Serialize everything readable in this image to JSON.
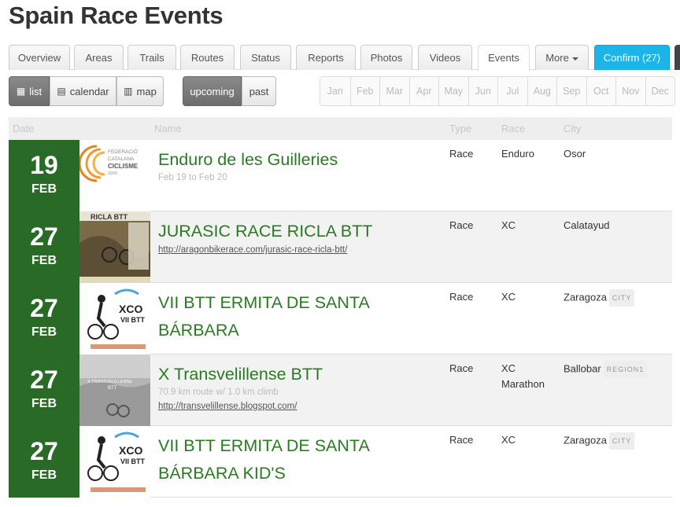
{
  "page": {
    "title": "Spain Race Events"
  },
  "tabs": [
    {
      "label": "Overview"
    },
    {
      "label": "Areas"
    },
    {
      "label": "Trails"
    },
    {
      "label": "Routes"
    },
    {
      "label": "Status"
    },
    {
      "label": "Reports"
    },
    {
      "label": "Photos"
    },
    {
      "label": "Videos"
    },
    {
      "label": "Events"
    },
    {
      "label": "More"
    },
    {
      "label": "Confirm (27)"
    }
  ],
  "view_buttons": {
    "list": "list",
    "calendar": "calendar",
    "map": "map"
  },
  "time_buttons": {
    "upcoming": "upcoming",
    "past": "past"
  },
  "months": [
    "Jan",
    "Feb",
    "Mar",
    "Apr",
    "May",
    "Jun",
    "Jul",
    "Aug",
    "Sep",
    "Oct",
    "Nov",
    "Dec"
  ],
  "table": {
    "headers": {
      "date": "Date",
      "name": "Name",
      "type": "Type",
      "race": "Race",
      "city": "City"
    },
    "rows": [
      {
        "day": "19",
        "month": "FEB",
        "name": "Enduro de les Guilleries",
        "sub": "Feb 19 to Feb 20",
        "link": "",
        "type": "Race",
        "race": "Enduro",
        "city": "Osor",
        "badge": "",
        "thumb_text": "FEDERACIÓ CATALANA CICLISME 1896"
      },
      {
        "day": "27",
        "month": "FEB",
        "name": "JURASIC RACE RICLA BTT",
        "sub": "",
        "link": "http://aragonbikerace.com/jurasic-race-ricla-btt/",
        "type": "Race",
        "race": "XC",
        "city": "Calatayud",
        "badge": "",
        "thumb_text": "RICLA BTT"
      },
      {
        "day": "27",
        "month": "FEB",
        "name": "VII BTT ERMITA DE SANTA BÁRBARA",
        "sub": "",
        "link": "",
        "type": "Race",
        "race": "XC",
        "city": "Zaragoza",
        "badge": "CITY",
        "thumb_text": "XCO VII BTT"
      },
      {
        "day": "27",
        "month": "FEB",
        "name": "X Transvelillense BTT",
        "sub": "70.9 km route w/ 1.0 km climb",
        "link": "http://transvelillense.blogspot.com/",
        "type": "Race",
        "race": "XC Marathon",
        "city": "Ballobar",
        "badge": "REGION1",
        "thumb_text": "X TRANSVELILLENSE BTT"
      },
      {
        "day": "27",
        "month": "FEB",
        "name": "VII BTT ERMITA DE SANTA BÁRBARA KID'S",
        "sub": "",
        "link": "",
        "type": "Race",
        "race": "XC",
        "city": "Zaragoza",
        "badge": "CITY",
        "thumb_text": "XCO VII BTT"
      }
    ]
  },
  "colors": {
    "date_green": "#2a6a27",
    "link_green": "#2a7a22",
    "confirm_blue": "#1bb5e9"
  }
}
